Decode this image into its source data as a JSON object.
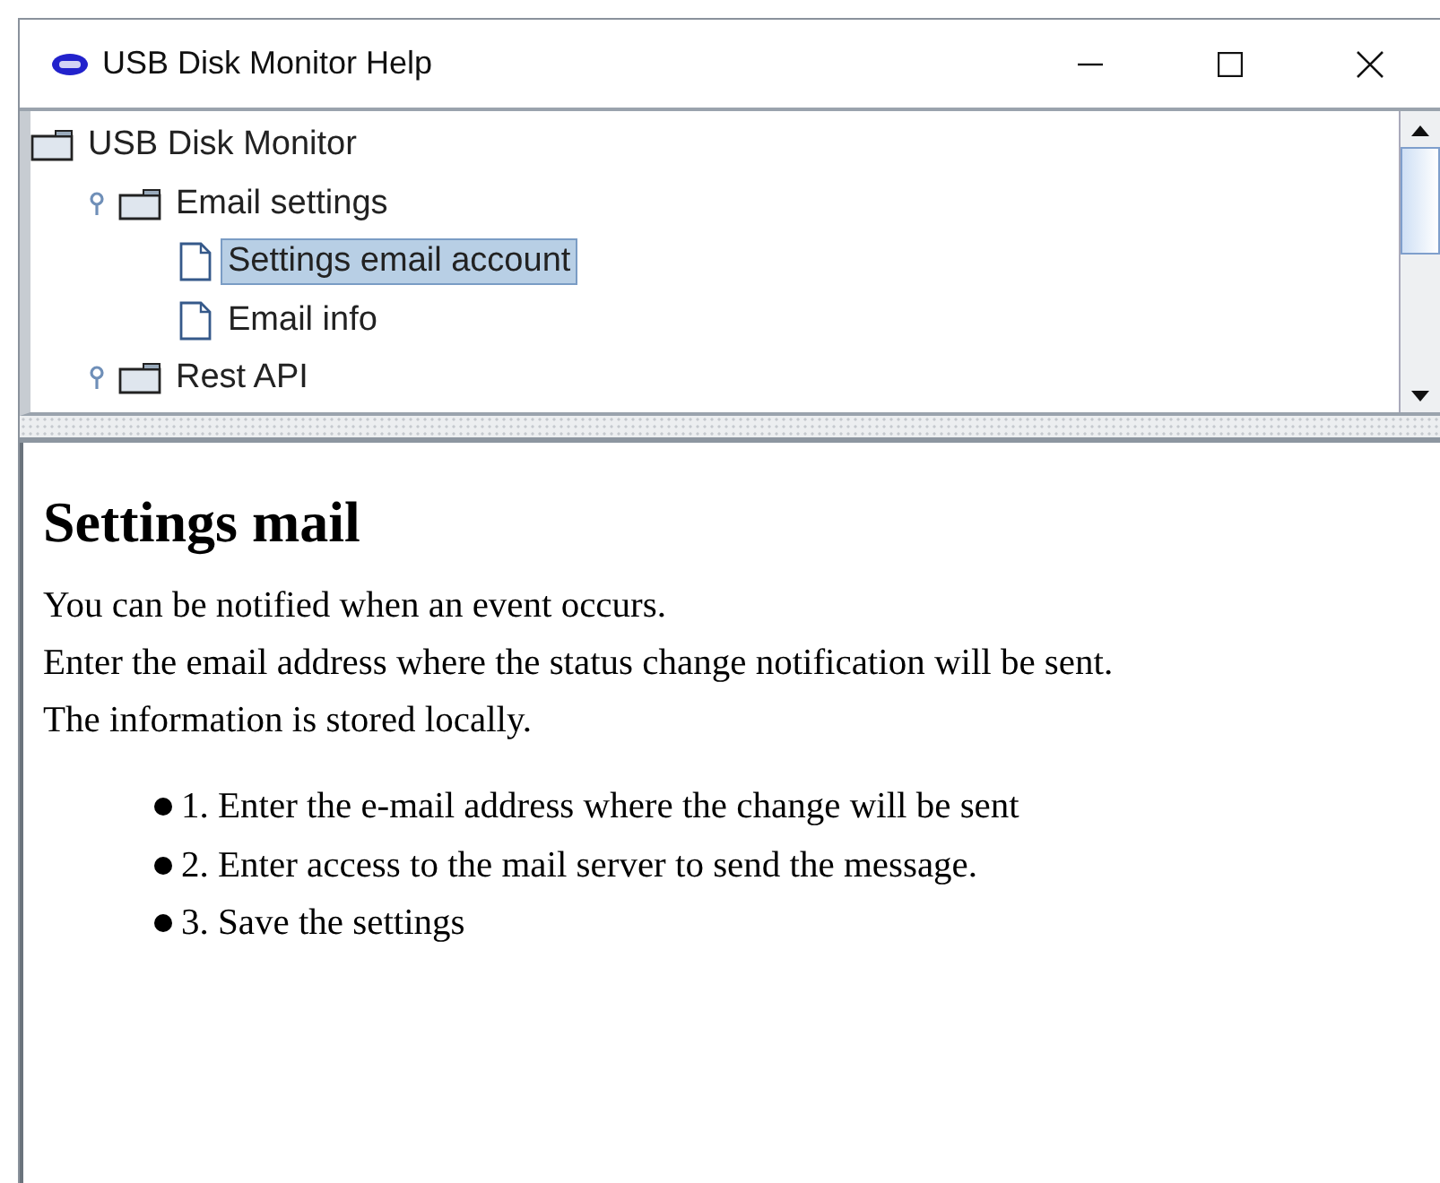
{
  "window": {
    "title": "USB Disk Monitor Help"
  },
  "tree": {
    "items": [
      {
        "label": "USB Disk Monitor",
        "kind": "folder",
        "selected": false,
        "children": [
          {
            "label": "Email settings",
            "kind": "folder",
            "expanded": true,
            "selected": false,
            "children": [
              {
                "label": "Settings email account",
                "kind": "page",
                "selected": true
              },
              {
                "label": "Email info",
                "kind": "page",
                "selected": false
              }
            ]
          },
          {
            "label": "Rest API",
            "kind": "folder",
            "expanded": true,
            "selected": false
          }
        ]
      }
    ]
  },
  "content": {
    "heading": "Settings mail",
    "paragraph_lines": [
      "You can be notified when an event occurs.",
      "Enter the email address where the status change notification will be sent.",
      "The information is stored locally."
    ],
    "list_items": [
      "1. Enter the e-mail address where the change will be sent",
      "2. Enter access to the mail server to send the message.",
      "3. Save the settings"
    ]
  }
}
